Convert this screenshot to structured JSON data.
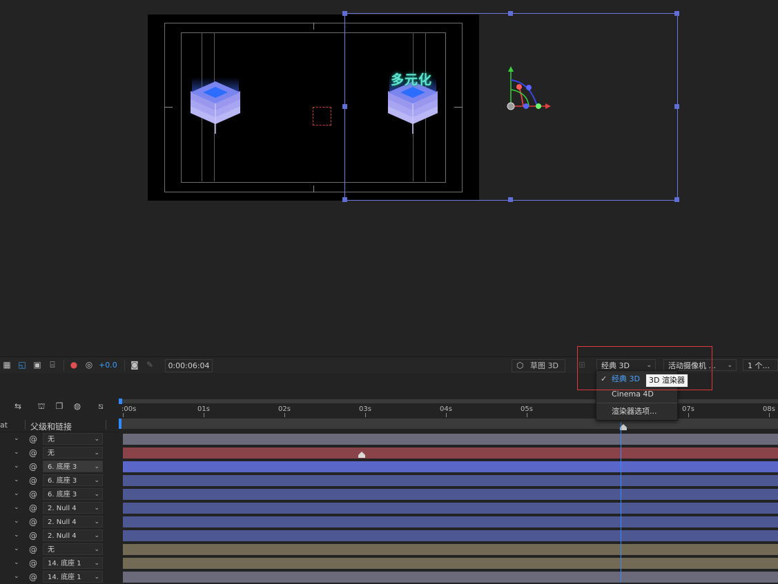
{
  "viewer": {
    "comp_title_text": "多元化"
  },
  "toolbar": {
    "plus_value": "+0.0",
    "timecode": "0:00:06:04",
    "draft3d_label": "草图 3D",
    "renderer_value": "经典 3D",
    "camera_value": "活动摄像机 ...",
    "views_value": "1 个..."
  },
  "renderer_menu": {
    "items": [
      {
        "label": "经典 3D",
        "checked": true
      },
      {
        "label": "Cinema 4D",
        "checked": false
      },
      {
        "label": "渲染器选项...",
        "checked": false
      }
    ],
    "tooltip": "3D 渲染器"
  },
  "timeline": {
    "left_col_fragment": "at",
    "parent_col_label": "父级和链接",
    "ruler_labels": [
      ":00s",
      "01s",
      "02s",
      "03s",
      "04s",
      "05s",
      "07s",
      "08s"
    ],
    "rows": [
      {
        "parent": "无",
        "color": "#6a6a7a"
      },
      {
        "parent": "无",
        "color": "#8a4449"
      },
      {
        "parent": "6. 底座 3",
        "color": "#5a67c9"
      },
      {
        "parent": "6. 底座 3",
        "color": "#4d5792"
      },
      {
        "parent": "6. 底座 3",
        "color": "#4d5792"
      },
      {
        "parent": "2. Null 4",
        "color": "#4d5792"
      },
      {
        "parent": "2. Null 4",
        "color": "#4d5792"
      },
      {
        "parent": "2. Null 4",
        "color": "#4d5792"
      },
      {
        "parent": "无",
        "color": "#736a55"
      },
      {
        "parent": "14. 底座 1",
        "color": "#736a55"
      },
      {
        "parent": "14. 底座 1",
        "color": "#6a6a7a"
      }
    ]
  },
  "colors": {
    "accent_blue": "#2f8bff",
    "highlight_red": "#e0393b",
    "selection_blue": "#5f6fd6"
  }
}
